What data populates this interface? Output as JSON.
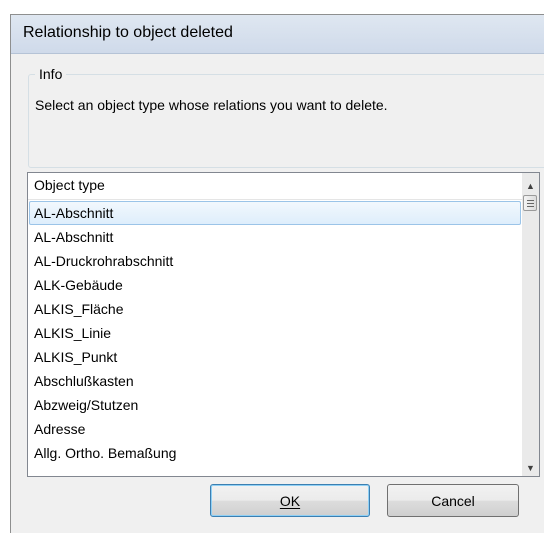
{
  "window": {
    "title": "Relationship to object deleted"
  },
  "info_group": {
    "legend": "Info",
    "text": "Select an object type whose relations you want to delete."
  },
  "list": {
    "header": "Object type",
    "items": [
      "AL-Abschnitt",
      "AL-Abschnitt",
      "AL-Druckrohrabschnitt",
      "ALK-Gebäude",
      "ALKIS_Fläche",
      "ALKIS_Linie",
      "ALKIS_Punkt",
      "Abschlußkasten",
      "Abzweig/Stutzen",
      "Adresse",
      "Allg. Ortho. Bemaßung"
    ],
    "selected_index": 0
  },
  "scrollbar": {
    "up_icon": "scroll-up-arrow-icon",
    "down_icon": "scroll-down-arrow-icon",
    "thumb_icon": "grip-icon"
  },
  "buttons": {
    "ok": "OK",
    "cancel": "Cancel"
  }
}
